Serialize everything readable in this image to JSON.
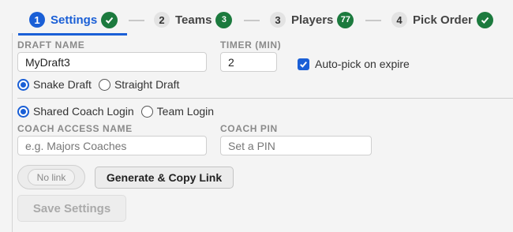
{
  "steps": [
    {
      "num": "1",
      "label": "Settings",
      "badge_type": "check",
      "active": true
    },
    {
      "num": "2",
      "label": "Teams",
      "badge": "3"
    },
    {
      "num": "3",
      "label": "Players",
      "badge": "77"
    },
    {
      "num": "4",
      "label": "Pick Order",
      "badge_type": "check"
    }
  ],
  "form": {
    "draft_name": {
      "label": "DRAFT NAME",
      "value": "MyDraft3"
    },
    "timer": {
      "label": "TIMER (MIN)",
      "value": "2"
    },
    "auto_pick": {
      "label": "Auto-pick on expire",
      "checked": true
    },
    "draft_type": {
      "options": [
        "Snake Draft",
        "Straight Draft"
      ],
      "selected": "Snake Draft"
    },
    "login_type": {
      "options": [
        "Shared Coach Login",
        "Team Login"
      ],
      "selected": "Shared Coach Login"
    },
    "coach_access_name": {
      "label": "COACH ACCESS NAME",
      "placeholder": "e.g. Majors Coaches",
      "value": ""
    },
    "coach_pin": {
      "label": "COACH PIN",
      "placeholder": "Set a PIN",
      "value": ""
    }
  },
  "link": {
    "status": "No link",
    "generate_label": "Generate & Copy Link"
  },
  "save_label": "Save Settings",
  "colors": {
    "accent": "#1a5fd6",
    "badge": "#1c7a3e"
  }
}
